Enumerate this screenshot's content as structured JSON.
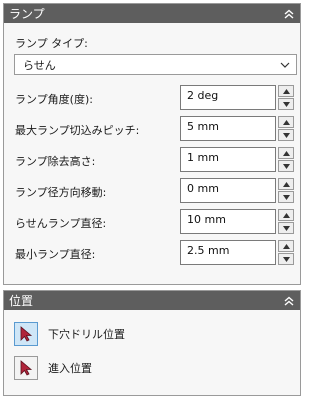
{
  "ramp_panel": {
    "title": "ランプ",
    "type_label": "ランプ タイプ:",
    "type_value": "らせん",
    "fields": [
      {
        "label": "ランプ角度(度):",
        "value": "2 deg"
      },
      {
        "label": "最大ランプ切込みピッチ:",
        "value": "5 mm"
      },
      {
        "label": "ランプ除去高さ:",
        "value": "1 mm"
      },
      {
        "label": "ランプ径方向移動:",
        "value": "0 mm"
      },
      {
        "label": "らせんランプ直径:",
        "value": "10 mm"
      },
      {
        "label": "最小ランプ直径:",
        "value": "2.5 mm"
      }
    ]
  },
  "position_panel": {
    "title": "位置",
    "items": [
      {
        "label": "下穴ドリル位置",
        "active": true
      },
      {
        "label": "進入位置",
        "active": false
      }
    ]
  },
  "colors": {
    "header": "#5e5e5e",
    "accent_arrow": "#b0243a",
    "active_bg": "#cfe6f7"
  },
  "icons": [
    "collapse-up-icon",
    "chevron-down-icon",
    "spin-up-icon",
    "spin-down-icon",
    "pointer-select-icon"
  ]
}
